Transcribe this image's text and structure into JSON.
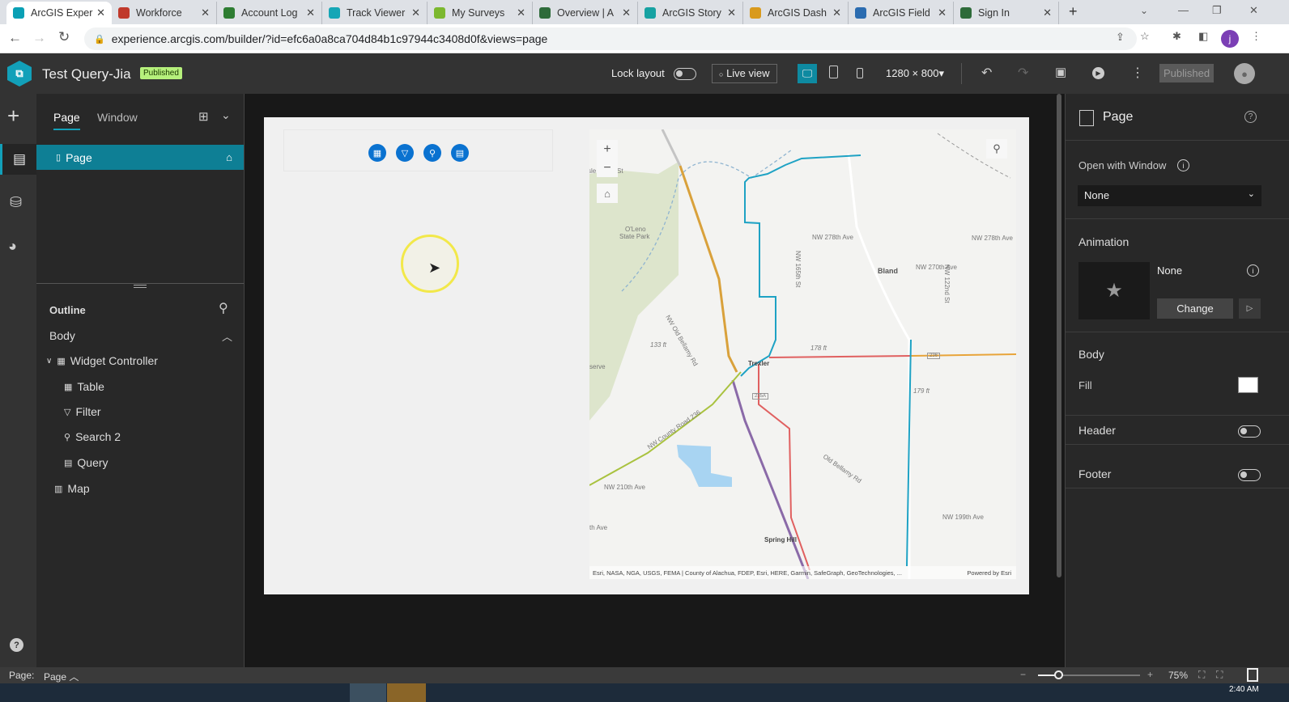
{
  "browser": {
    "tabs": [
      {
        "title": "ArcGIS Exper",
        "color": "#0aa0b5"
      },
      {
        "title": "Workforce",
        "color": "#c0392b"
      },
      {
        "title": "Account Log",
        "color": "#2e7d32"
      },
      {
        "title": "Track Viewer",
        "color": "#16a6b6"
      },
      {
        "title": "My Surveys",
        "color": "#7cb82f"
      },
      {
        "title": "Overview | A",
        "color": "#2e6b3a"
      },
      {
        "title": "ArcGIS Story",
        "color": "#17a2a2"
      },
      {
        "title": "ArcGIS Dash",
        "color": "#d99a1c"
      },
      {
        "title": "ArcGIS Field",
        "color": "#2b6cb0"
      },
      {
        "title": "Sign In",
        "color": "#2e6b3a"
      }
    ],
    "new_tab": "+",
    "url": "experience.arcgis.com/builder/?id=efc6a0a8ca704d84b1c97944c3408d0f&views=page",
    "profile_initial": "j"
  },
  "header": {
    "app_title": "Test Query-Jia",
    "status_badge": "Published",
    "lock_layout": "Lock layout",
    "live_view": "Live view",
    "resolution": "1280 × 800",
    "publish_button": "Published"
  },
  "left_panel": {
    "tabs": [
      "Page",
      "Window"
    ],
    "pages": [
      {
        "label": "Page"
      }
    ],
    "outline_title": "Outline",
    "body_label": "Body",
    "tree": [
      {
        "label": "Widget Controller",
        "icon": "grid-icon"
      },
      {
        "label": "Table",
        "icon": "table-icon"
      },
      {
        "label": "Filter",
        "icon": "filter-icon"
      },
      {
        "label": "Search 2",
        "icon": "search-icon"
      },
      {
        "label": "Query",
        "icon": "query-icon"
      },
      {
        "label": "Map",
        "icon": "map-icon"
      }
    ]
  },
  "right_panel": {
    "title": "Page",
    "open_with_window_label": "Open with Window",
    "open_with_window_value": "None",
    "animation_label": "Animation",
    "animation_value": "None",
    "change_button": "Change",
    "body_label": "Body",
    "fill_label": "Fill",
    "fill_color": "#ffffff",
    "header_label": "Header",
    "footer_label": "Footer"
  },
  "map": {
    "labels": {
      "oleno": "O'Leno",
      "state_park": "State Park",
      "camp": "sle Camp St",
      "nw278a": "NW 278th Ave",
      "nw278b": "NW 278th Ave",
      "nw270": "NW 270th Ave",
      "bland": "Bland",
      "trexler": "Trexler",
      "spring_hill": "Spring Hill",
      "nw210": "NW 210th Ave",
      "nw199": "NW 199th Ave",
      "old_bellamy": "Old Bellamy Rd",
      "nw_old_bellamy": "NW Old Bellamy Rd",
      "county_road": "NW County Road 236",
      "elev1": "133 ft",
      "elev2": "178 ft",
      "elev3": "179 ft",
      "shield1": "236",
      "shield2": "235A",
      "reserve": "serve",
      "ave_left": "th Ave",
      "nw165": "NW 165th St",
      "nw122": "NW 122nd St"
    },
    "attribution": "Esri, NASA, NGA, USGS, FEMA | County of Alachua, FDEP, Esri, HERE, Garmin, SafeGraph, GeoTechnologies, ...",
    "powered_by": "Powered by Esri",
    "zoom_in": "+",
    "zoom_out": "−"
  },
  "bottom_bar": {
    "page_label": "Page:",
    "page_value": "Page",
    "zoom_percent": "75%",
    "zoom_fraction": 0.2
  },
  "taskbar": {
    "time": "2:40 AM"
  }
}
